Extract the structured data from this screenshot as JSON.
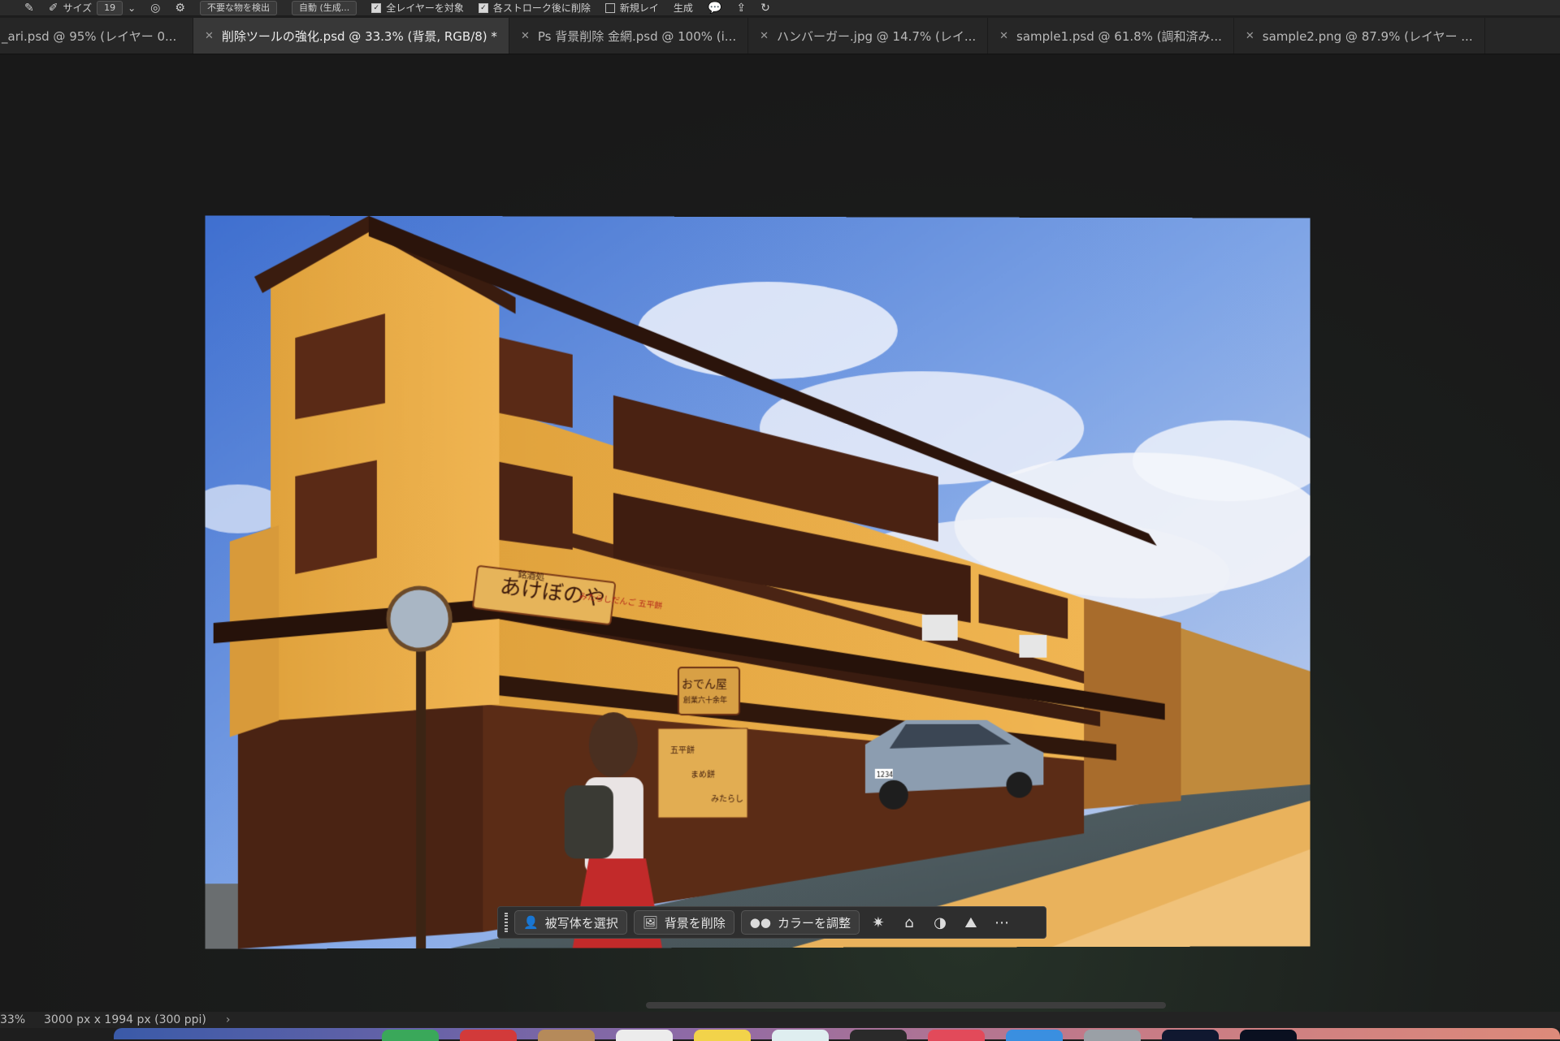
{
  "app": "Adobe Photoshop",
  "options_bar": {
    "size_label": "サイズ",
    "size_value": "19",
    "detect_dropdown": "不要な物を検出",
    "mode_dropdown": "自動 (生成...",
    "check_all_layers": "全レイヤーを対象",
    "check_delete_after_stroke": "各ストローク後に削除",
    "check_new_layer": "新規レイ",
    "generate_label": "生成"
  },
  "tabs": [
    {
      "label": "_ari.psd @ 95% (レイヤー 0...",
      "active": false
    },
    {
      "label": "削除ツールの強化.psd @ 33.3% (背景, RGB/8) *",
      "active": true
    },
    {
      "label": "Ps 背景削除 金網.psd @ 100% (i...",
      "active": false
    },
    {
      "label": "ハンバーガー.jpg @ 14.7% (レイ...",
      "active": false
    },
    {
      "label": "sample1.psd @ 61.8% (調和済み...",
      "active": false
    },
    {
      "label": "sample2.png @ 87.9% (レイヤー ...",
      "active": false
    }
  ],
  "photo": {
    "main_sign": "あけぼのや",
    "main_sign_small": "銘酒処",
    "main_sign_side": "みたらしだんご 五平餅",
    "shop_sign": "おでん屋",
    "shop_sign_small": "創業六十余年",
    "vertical_signs": [
      "五平餅",
      "まめ餅",
      "みたらし"
    ],
    "plate": "1234"
  },
  "taskbar": {
    "select_subject": "被写体を選択",
    "remove_background": "背景を削除",
    "adjust_color": "カラーを調整"
  },
  "status": {
    "zoom": "33%",
    "doc_info": "3000 px x 1994 px (300 ppi)"
  },
  "colors": {
    "background": "#1e1e1e",
    "panel": "#2b2b2b",
    "tab_active": "#383838"
  }
}
